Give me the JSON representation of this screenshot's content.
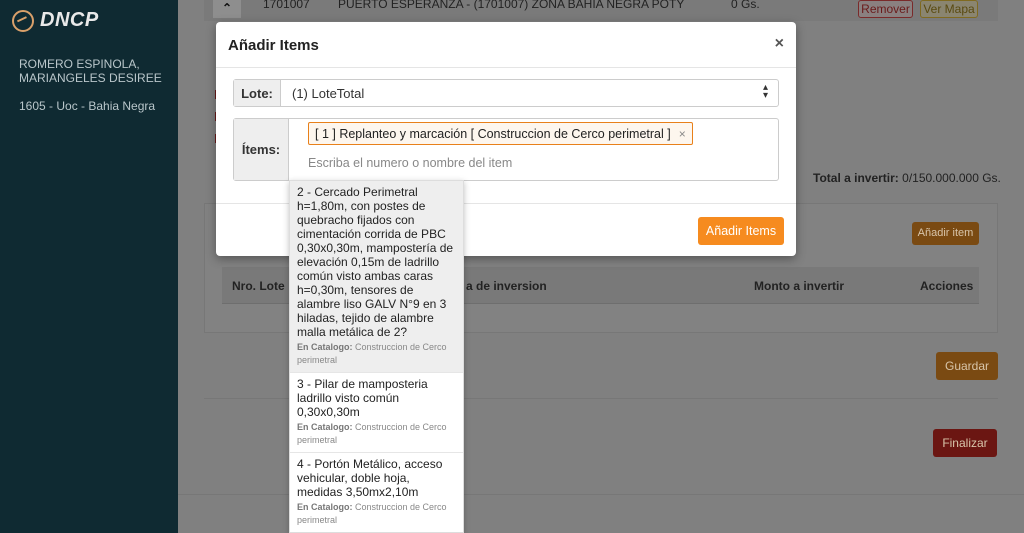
{
  "sidebar": {
    "logo": "DNCP",
    "user_name": "ROMERO ESPINOLA, MARIANGELES DESIREE",
    "user_unit": "1605 - Uoc - Bahia Negra"
  },
  "background": {
    "row_code": "1701007",
    "row_place": "PUERTO ESPERANZA - (1701007) ZONA BAHIA NEGRA POTY",
    "row_amount": "0 Gs.",
    "collapse_glyph": "⌃",
    "remover_label": "Remover",
    "ver_mapa_label": "Ver Mapa",
    "total_label": "Total a invertir:",
    "total_value": "0/150.000.000 Gs.",
    "anadir_item_label": "Añadir item",
    "col_nro_lote": "Nro. Lote",
    "col_inversion": "a de inversion",
    "col_monto": "Monto a invertir",
    "col_acciones": "Acciones",
    "guardar_label": "Guardar",
    "finalizar_label": "Finalizar"
  },
  "modal": {
    "title": "Añadir Items",
    "close_glyph": "×",
    "lote_label": "Lote:",
    "lote_value": "(1) LoteTotal",
    "items_label": "Ítems:",
    "selected_tag": "[ 1 ] Replanteo y marcación [ Construccion de Cerco perimetral ]",
    "tag_remove_glyph": "×",
    "search_placeholder": "Escriba el numero o nombre del item",
    "submit_label": "Añadir Items"
  },
  "dropdown": {
    "catalog_label": "En Catalogo:",
    "items": [
      {
        "name": "2 - Cercado Perimetral h=1,80m, con postes de quebracho fijados con cimentación corrida de PBC 0,30x0,30m, mampostería de elevación 0,15m de ladrillo común visto ambas caras h=0,30m, tensores de alambre liso GALV N°9 en 3 hiladas, tejido de alambre malla metálica de 2?",
        "catalog": "Construccion de Cerco perimetral"
      },
      {
        "name": "3 - Pilar de mamposteria ladrillo visto común 0,30x0,30m",
        "catalog": "Construccion de Cerco perimetral"
      },
      {
        "name": "4 - Portón Metálico, acceso vehicular, doble hoja, medidas 3,50mx2,10m",
        "catalog": "Construccion de Cerco perimetral"
      }
    ]
  },
  "colors": {
    "accent": "#f68b1f",
    "sidebar": "#0f2a32",
    "tag_border": "#e8801a"
  }
}
